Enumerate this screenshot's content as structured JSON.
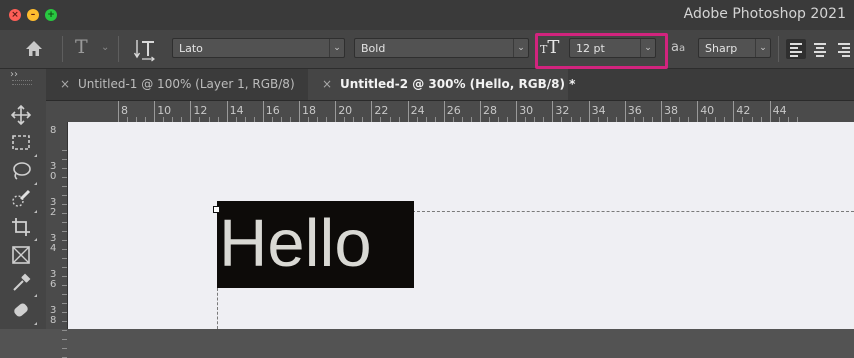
{
  "window": {
    "app_title": "Adobe Photoshop 2021"
  },
  "options_bar": {
    "font_family": "Lato",
    "font_style": "Bold",
    "font_size": "12 pt",
    "anti_alias": "Sharp",
    "highlight_color": "#d2247e"
  },
  "tabs": [
    {
      "close": "×",
      "label": "Untitled-1 @ 100% (Layer 1, RGB/8)",
      "active": false
    },
    {
      "close": "×",
      "label": "Untitled-2 @ 300% (Hello, RGB/8) *",
      "active": true
    }
  ],
  "ruler_top": [
    "8",
    "10",
    "12",
    "14",
    "16",
    "18",
    "20",
    "22",
    "24",
    "26",
    "28",
    "30",
    "32",
    "34",
    "36",
    "38",
    "40",
    "42",
    "44"
  ],
  "ruler_left": [
    [
      "8"
    ],
    [
      "3",
      "0"
    ],
    [
      "3",
      "2"
    ],
    [
      "3",
      "4"
    ],
    [
      "3",
      "6"
    ],
    [
      "3",
      "8"
    ]
  ],
  "canvas": {
    "text_layer": "Hello"
  },
  "tools": [
    "move-icon",
    "marquee-icon",
    "lasso-icon",
    "quick-select-icon",
    "crop-icon",
    "frame-icon",
    "eyedropper-icon",
    "healing-brush-icon"
  ]
}
